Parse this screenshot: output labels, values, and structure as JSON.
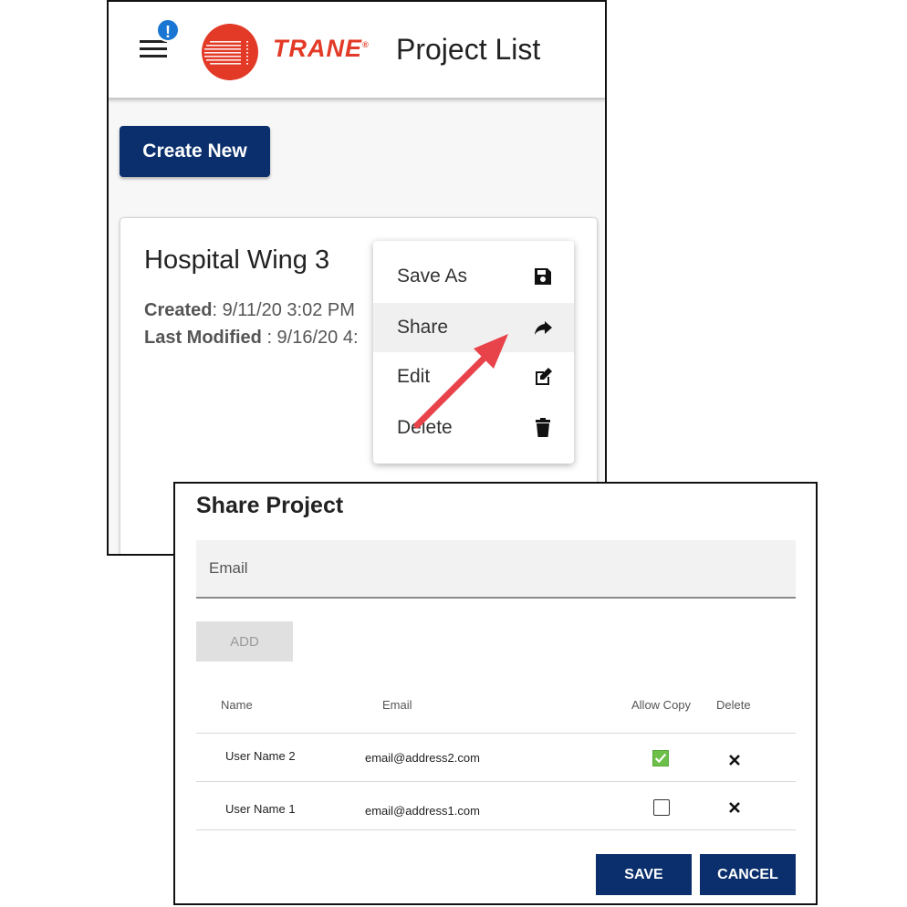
{
  "appbar": {
    "title": "Project List",
    "brand": "TRANE",
    "brand_mark": "®",
    "notification_badge": "!",
    "brand_color": "#e33a27",
    "badge_color": "#1976d2"
  },
  "actions": {
    "create_new": "Create New"
  },
  "project_card": {
    "title": "Hospital Wing 3",
    "created_label": "Created",
    "created_value": ": 9/11/20 3:02 PM",
    "modified_label": "Last Modified",
    "modified_value": " : 9/16/20 4:"
  },
  "context_menu": {
    "items": [
      {
        "label": "Save As",
        "icon": "floppy-disk-icon"
      },
      {
        "label": "Share",
        "icon": "share-arrow-icon",
        "highlighted": true
      },
      {
        "label": "Edit",
        "icon": "edit-pencil-icon"
      },
      {
        "label": "Delete",
        "icon": "trash-icon"
      }
    ]
  },
  "share_dialog": {
    "title": "Share Project",
    "email_placeholder": "Email",
    "email_value": "",
    "add_label": "ADD",
    "columns": [
      "Name",
      "Email",
      "Allow Copy",
      "Delete"
    ],
    "rows": [
      {
        "name": "User Name 2",
        "email": "email@address2.com",
        "allow_copy": true
      },
      {
        "name": "User Name 1",
        "email": "email@address1.com",
        "allow_copy": false
      }
    ],
    "save_label": "SAVE",
    "cancel_label": "CANCEL"
  },
  "colors": {
    "primary": "#0a2f6c",
    "check_on": "#6cc04a",
    "annotation_arrow": "#e8434a"
  }
}
